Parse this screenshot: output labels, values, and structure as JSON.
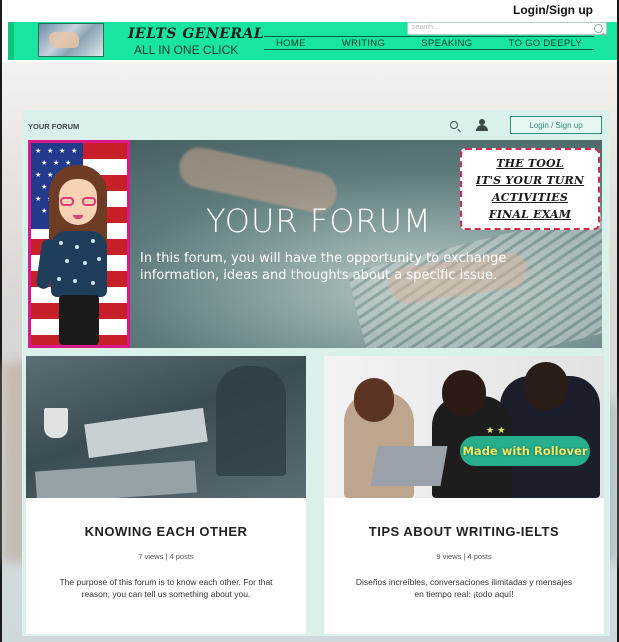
{
  "top_login": "Login/Sign up",
  "header": {
    "brand_title": "IELTS GENERAL",
    "brand_sub": "ALL IN ONE CLICK",
    "nav": [
      "HOME",
      "WRITING",
      "SPEAKING",
      "TO GO DEEPLY"
    ],
    "search_placeholder": "search..."
  },
  "panel": {
    "label": "YOUR FORUM",
    "login": "Login / Sign up"
  },
  "hero": {
    "title": "YOUR FORUM",
    "description": "In this forum, you will have the opportunity to exchange information, ideas and thoughts about a specific issue.",
    "tool_items": [
      "THE TOOL",
      "IT'S YOUR TURN",
      "ACTIVITIES",
      "FINAL EXAM"
    ]
  },
  "cards": [
    {
      "title": "KNOWING EACH OTHER",
      "meta": "7 views | 4 posts",
      "description": "The purpose of this forum is to know each other. For that reason, you can tell us something about you."
    },
    {
      "title": "TIPS ABOUT WRITING-IELTS",
      "meta": "9 views | 4 posts",
      "description": "Diseños increíbles, conversaciones ilimitadas y mensajes en tiempo real: ¡todo aquí!",
      "badge": "Made with Rollover"
    }
  ],
  "colors": {
    "header_bg": "#18e6a0",
    "panel_bg": "#d9f1ea",
    "accent": "#2f8f7a",
    "toolbox_border": "#d22a4a"
  }
}
